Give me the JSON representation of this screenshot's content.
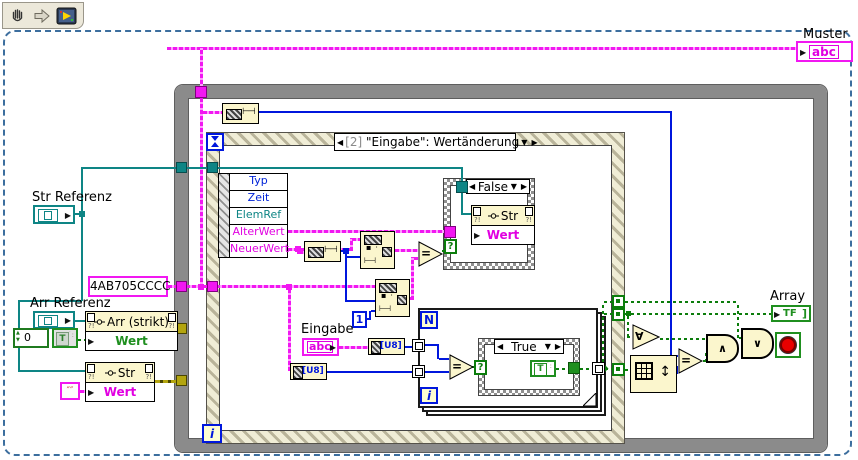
{
  "colors": {
    "string_pink": "#f118f1",
    "refnum_teal": "#0e8585",
    "integer_blue": "#0017dd",
    "boolean_green": "#0c7d0c",
    "error_olive": "#8f8414",
    "node_fill": "#fbf6cd",
    "loop_border_gray": "#8b8b8b",
    "outer_dashed_blue": "#3c6e9e"
  },
  "indicators": {
    "muster_label": "Muster",
    "muster_glyph": "abc",
    "array_label": "Array",
    "array_glyph": "TF",
    "array_bracket": "]"
  },
  "controls": {
    "str_ref_label": "Str Referenz",
    "arr_ref_label": "Arr Referenz",
    "eingabe_label": "Eingabe",
    "eingabe_glyph": "abc"
  },
  "constants": {
    "pattern": "4AB705CCCC",
    "array_index": "0",
    "bool_element": "T",
    "true_value": "T",
    "one": "1",
    "empty_string": "″″"
  },
  "property_nodes": {
    "arr": {
      "class_name": "Arr (strikt)",
      "property": "Wert"
    },
    "str_left": {
      "class_name": "Str",
      "property": "Wert"
    },
    "str_false_case": {
      "class_name": "Str",
      "property": "Wert"
    }
  },
  "event_structure": {
    "case_number": "[2]",
    "case_title": "\"Eingabe\": Wertänderung",
    "data_node_rows": [
      "Typ",
      "Zeit",
      "ElemRef",
      "AlterWert",
      "NeuerWert"
    ]
  },
  "case_structures": {
    "outer_label": "False",
    "inner_label": "True",
    "selector_glyph": "?"
  },
  "loops": {
    "for_count": "N",
    "for_iterator": "i",
    "while_iterator": "i"
  },
  "functions": {
    "equals_glyph": "=",
    "and_array_glyph": "∀",
    "and_glyph": "∧",
    "or_glyph": "∨",
    "byte_array_glyph": "[U8]",
    "array_size_glyph": "↕",
    "ruler_glyph": "⊢⊣"
  },
  "glyphs": {
    "right_arrow": "▶",
    "left_arrow": "◀",
    "down_arrow": "▼"
  }
}
